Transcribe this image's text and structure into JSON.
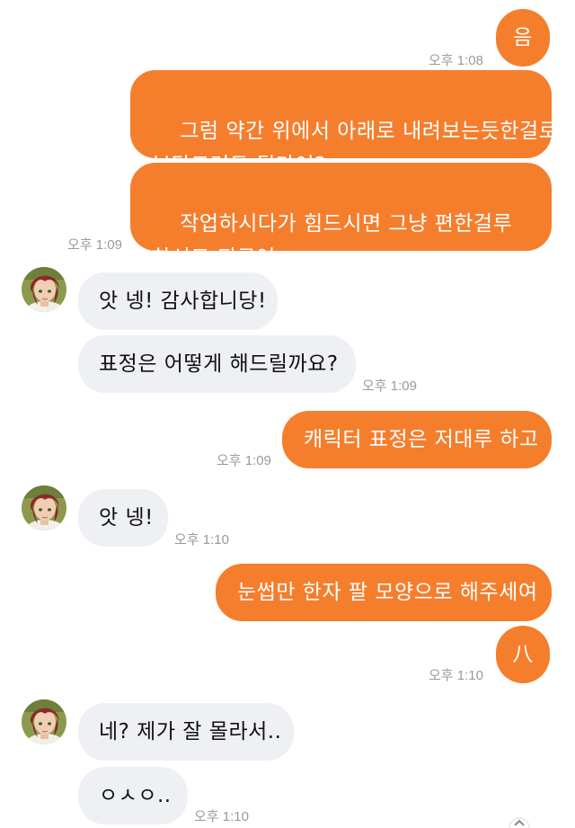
{
  "messages": [
    {
      "sender": "me",
      "text": "음"
    },
    {
      "sender": "me",
      "time": "오후 1:08"
    },
    {
      "sender": "me",
      "text": "그럼 약간 위에서 아래로 내려보는듯한걸로\n부탁드려두 될가여?"
    },
    {
      "sender": "me",
      "text": "작업하시다가 힘드시면 그냥 편한걸루\n하셔도 되구여",
      "time": "오후 1:09"
    },
    {
      "sender": "other",
      "text": "앗 넹! 감사합니당!"
    },
    {
      "sender": "other",
      "text": "표정은 어떻게 해드릴까요?",
      "time": "오후 1:09"
    },
    {
      "sender": "me",
      "text": "캐릭터 표정은 저대루 하고",
      "time": "오후 1:09"
    },
    {
      "sender": "other",
      "text": "앗 넹!",
      "time": "오후 1:10"
    },
    {
      "sender": "me",
      "text": "눈썹만 한자 팔 모양으로 해주세여"
    },
    {
      "sender": "me",
      "text": "八",
      "time": "오후 1:10"
    },
    {
      "sender": "other",
      "text": "네? 제가 잘 몰라서.."
    },
    {
      "sender": "other",
      "text": "ㅇㅅㅇ..",
      "time": "오후 1:10"
    }
  ],
  "colors": {
    "outgoing_bubble": "#f57e2d",
    "incoming_bubble": "#eef0f3",
    "timestamp": "#9a9a9a"
  }
}
